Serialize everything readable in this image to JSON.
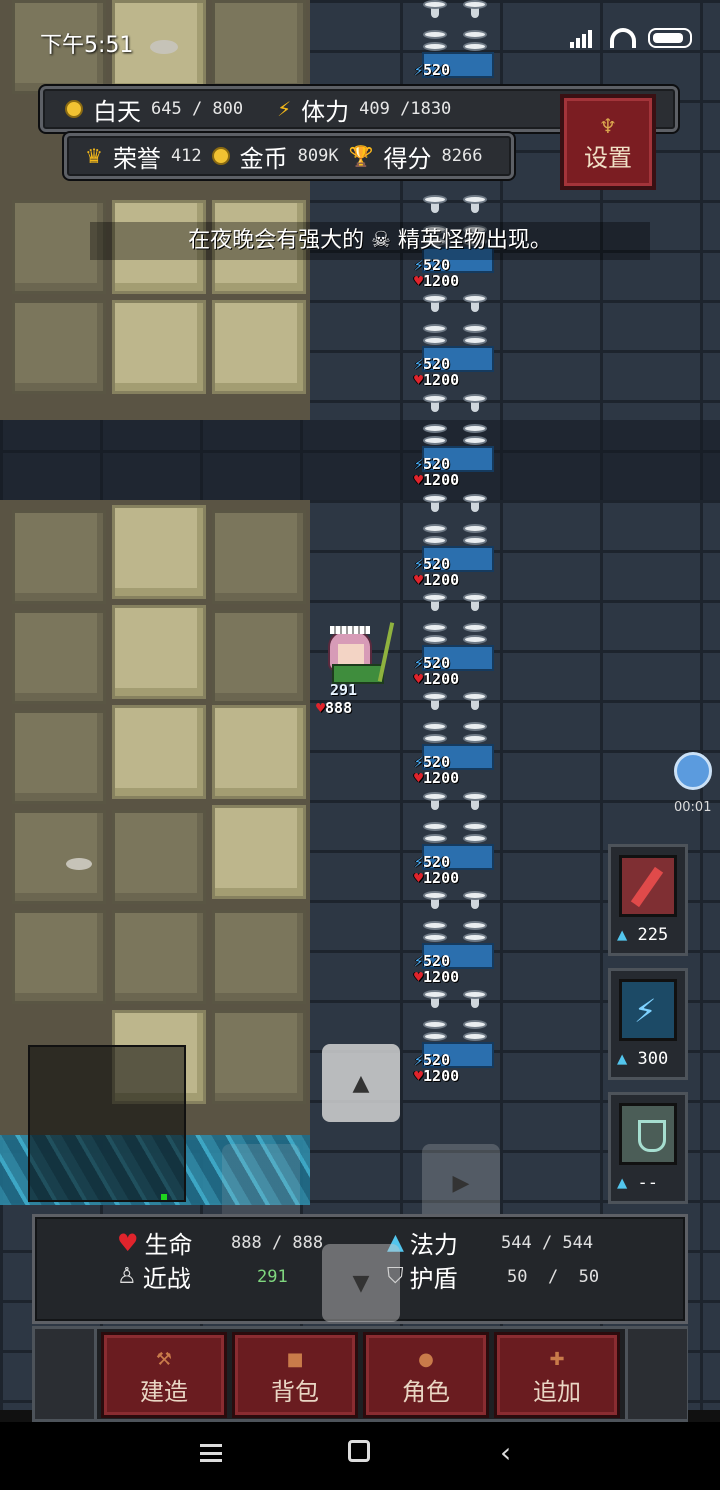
{
  "status_bar": {
    "time": "下午5:51"
  },
  "hud": {
    "day_label": "白天",
    "day_value": "645 / 800",
    "stamina_label": "体力",
    "stamina_value": "409 /1830",
    "honor_label": "荣誉",
    "honor_value": "412",
    "gold_label": "金币",
    "gold_value": "809K",
    "score_label": "得分",
    "score_value": "8266",
    "settings_label": "设置"
  },
  "notice": "在夜晚会有强大的 ☠ 精英怪物出现。",
  "turret": {
    "attack": "520",
    "hp": "1200"
  },
  "player": {
    "attack": "291",
    "hp": "888"
  },
  "skills": [
    {
      "name": "sword-skill",
      "cost": "225"
    },
    {
      "name": "lightning-skill",
      "cost": "300"
    },
    {
      "name": "shield-skill",
      "cost": "--"
    }
  ],
  "record_time": "00:01",
  "stats": {
    "life_label": "生命",
    "life_value": "888 / 888",
    "melee_label": "近战",
    "melee_value": "291",
    "mana_label": "法力",
    "mana_value": "544 / 544",
    "shield_label": "护盾",
    "shield_value": "50  /  50"
  },
  "menu": {
    "build": "建造",
    "bag": "背包",
    "character": "角色",
    "add": "追加"
  },
  "colors": {
    "accent_red": "#6a1c20",
    "gold": "#f1c232",
    "mana": "#53c6ee",
    "health": "#e0242c"
  }
}
